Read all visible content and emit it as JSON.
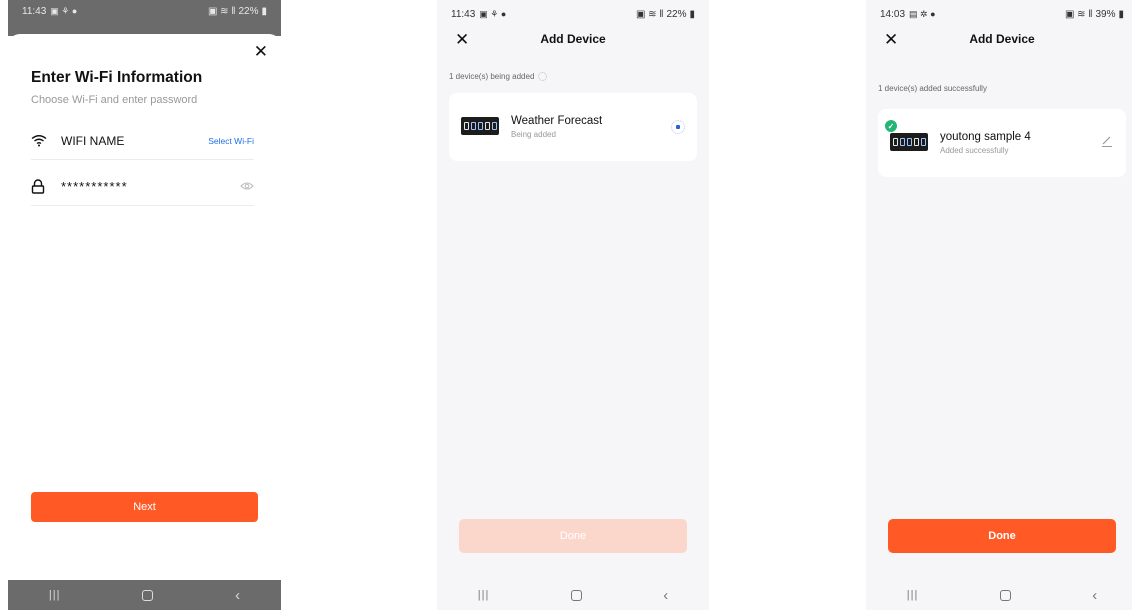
{
  "screens": [
    {
      "status": {
        "time": "11:43",
        "battery": "22%"
      },
      "title": "Enter Wi-Fi Information",
      "subtitle": "Choose Wi-Fi and enter password",
      "wifi_name": "WIFI NAME",
      "select_wifi_label": "Select Wi-Fi",
      "password": "***********",
      "next_label": "Next"
    },
    {
      "status": {
        "time": "11:43",
        "battery": "22%"
      },
      "title": "Add Device",
      "progress": "1 device(s) being added",
      "device": {
        "name": "Weather Forecast",
        "status": "Being added"
      },
      "done_label": "Done",
      "done_enabled": false
    },
    {
      "status": {
        "time": "14:03",
        "battery": "39%"
      },
      "title": "Add Device",
      "progress": "1 device(s) added successfully",
      "device": {
        "name": "youtong sample 4",
        "status": "Added successfully"
      },
      "done_label": "Done",
      "done_enabled": true
    }
  ],
  "icons": {
    "close": "close-icon",
    "wifi": "wifi-icon",
    "lock": "lock-icon",
    "eye": "eye-icon",
    "edit": "pencil-icon",
    "check": "check-circle-icon"
  },
  "colors": {
    "accent": "#ff5a26",
    "accent_disabled": "#fbd6ca",
    "link": "#1f6fe5",
    "success": "#22b573"
  }
}
